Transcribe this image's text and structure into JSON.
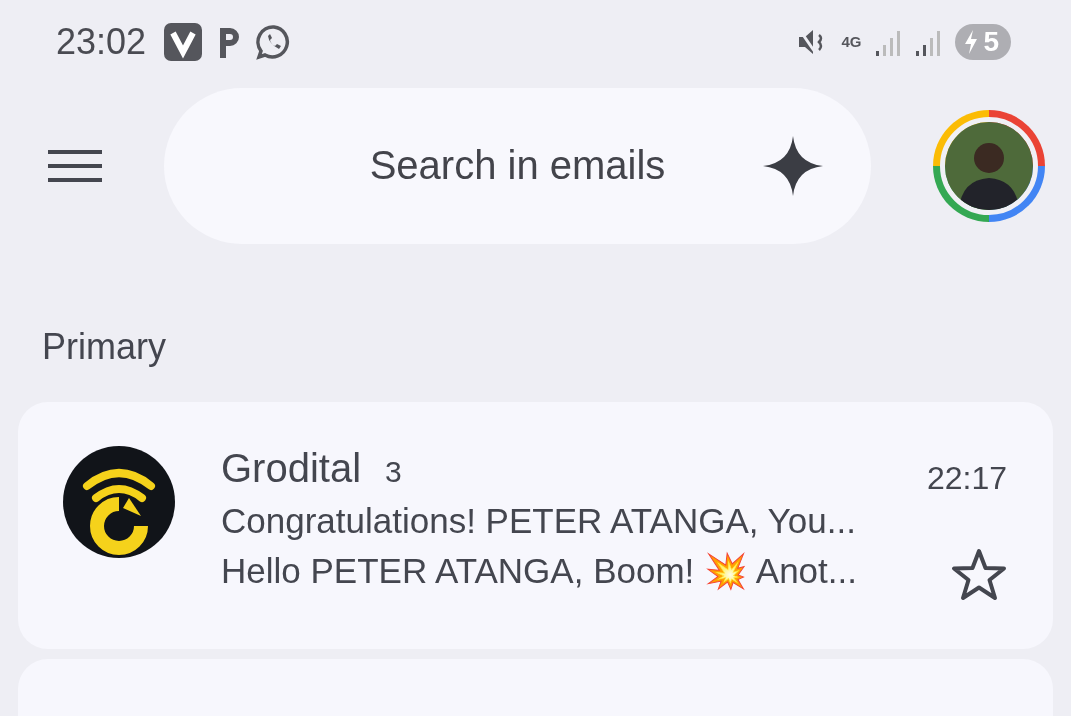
{
  "status_bar": {
    "time": "23:02",
    "network": "4G",
    "battery": "5",
    "charging": true
  },
  "search": {
    "placeholder": "Search in emails"
  },
  "section": {
    "title": "Primary"
  },
  "emails": [
    {
      "sender": "Grodital",
      "count": "3",
      "time": "22:17",
      "subject": "Congratulations! PETER ATANGA, You...",
      "snippet": "Hello PETER ATANGA, Boom! 💥 Anot...",
      "starred": false,
      "unread": false
    }
  ]
}
